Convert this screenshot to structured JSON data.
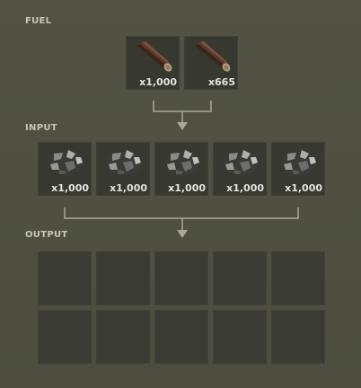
{
  "fuel": {
    "label": "FUEL",
    "slots": [
      {
        "item": "wood-log-icon",
        "quantity": "x1,000"
      },
      {
        "item": "wood-log-icon",
        "quantity": "x665"
      }
    ]
  },
  "input": {
    "label": "INPUT",
    "slots": [
      {
        "item": "ore-rock-icon",
        "quantity": "x1,000"
      },
      {
        "item": "ore-rock-icon",
        "quantity": "x1,000"
      },
      {
        "item": "ore-rock-icon",
        "quantity": "x1,000"
      },
      {
        "item": "ore-rock-icon",
        "quantity": "x1,000"
      },
      {
        "item": "ore-rock-icon",
        "quantity": "x1,000"
      }
    ]
  },
  "output": {
    "label": "OUTPUT",
    "slot_count": 10
  },
  "colors": {
    "panel": "#4d4e3f",
    "slot": "#373830",
    "label": "#c8c6ba",
    "connector": "#a9a79a"
  }
}
